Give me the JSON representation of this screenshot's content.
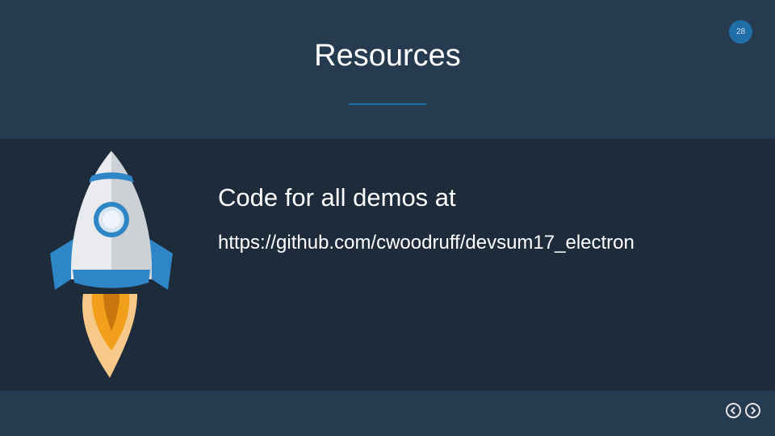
{
  "slide": {
    "title": "Resources",
    "number": "28",
    "lines": [
      "Code for all demos at",
      "https://github.com/cwoodruff/devsum17_electron"
    ]
  },
  "icons": {
    "illustration": "rocket-icon",
    "previous": "chevron-left-icon",
    "next": "chevron-right-icon"
  },
  "colors": {
    "background": "#263a50",
    "content_band": "#1e2b3b",
    "accent": "#1f6ea8",
    "text": "#ffffff"
  }
}
